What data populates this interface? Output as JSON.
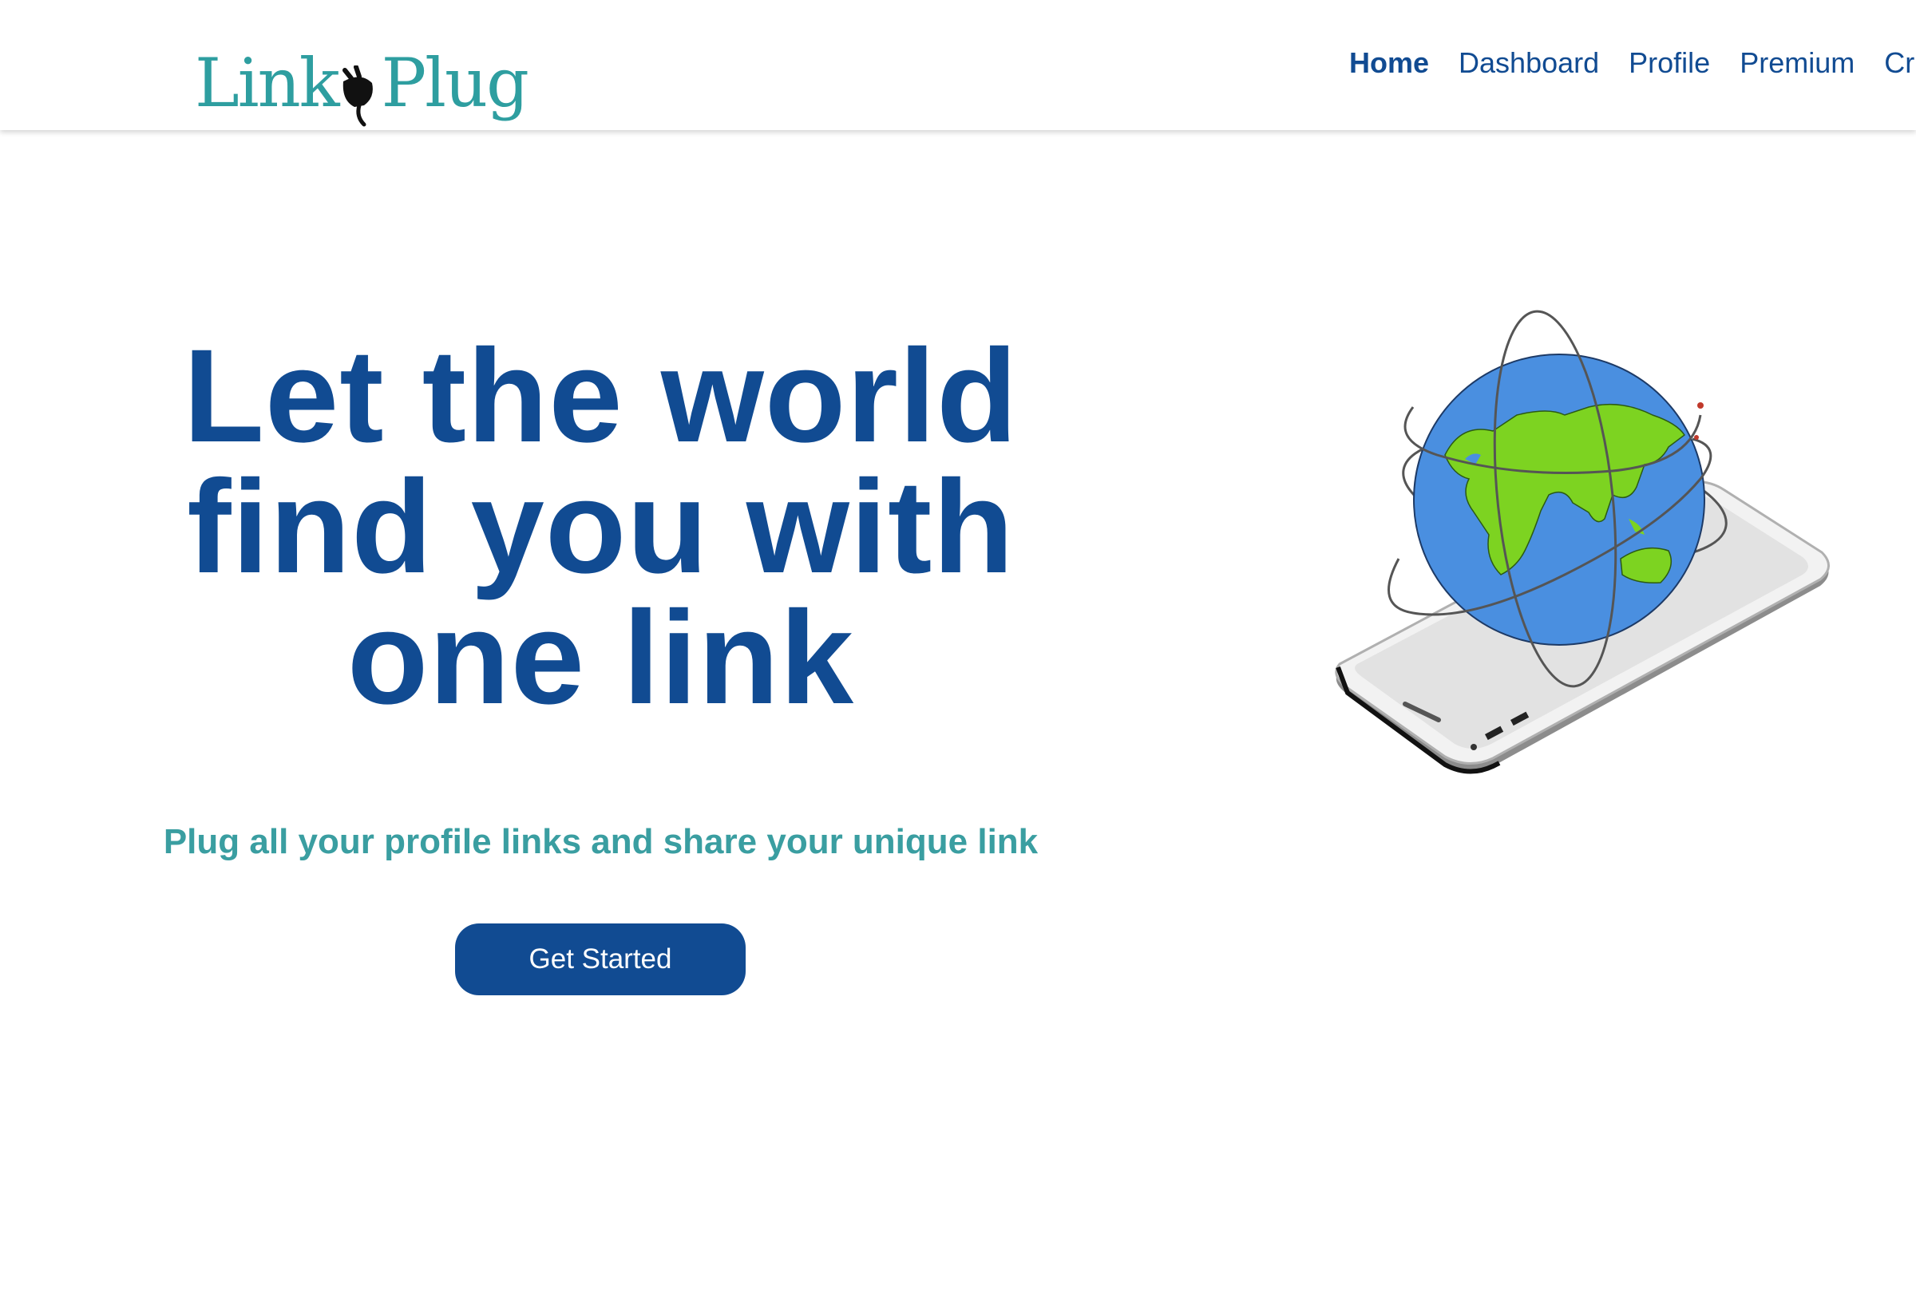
{
  "brand": {
    "logo_text_left": "Link",
    "logo_text_right": "Plug",
    "logo_color": "#2e9ea0",
    "logo_icon": "plug-icon"
  },
  "nav": {
    "items": [
      {
        "label": "Home",
        "active": true
      },
      {
        "label": "Dashboard",
        "active": false
      },
      {
        "label": "Profile",
        "active": false
      },
      {
        "label": "Premium",
        "active": false
      },
      {
        "label": "Cr",
        "active": false
      }
    ]
  },
  "hero": {
    "title_line1": "Let the world",
    "title_line2": "find you with",
    "title_line3": "one link",
    "subtitle": "Plug all your profile links and share your unique link",
    "cta_label": "Get Started",
    "illustration": "globe-on-smartphone-illustration"
  },
  "colors": {
    "primary": "#114b92",
    "accent": "#3a9ea1",
    "background": "#ffffff",
    "globe_ocean": "#4a8fe0",
    "globe_land": "#7dd321"
  }
}
